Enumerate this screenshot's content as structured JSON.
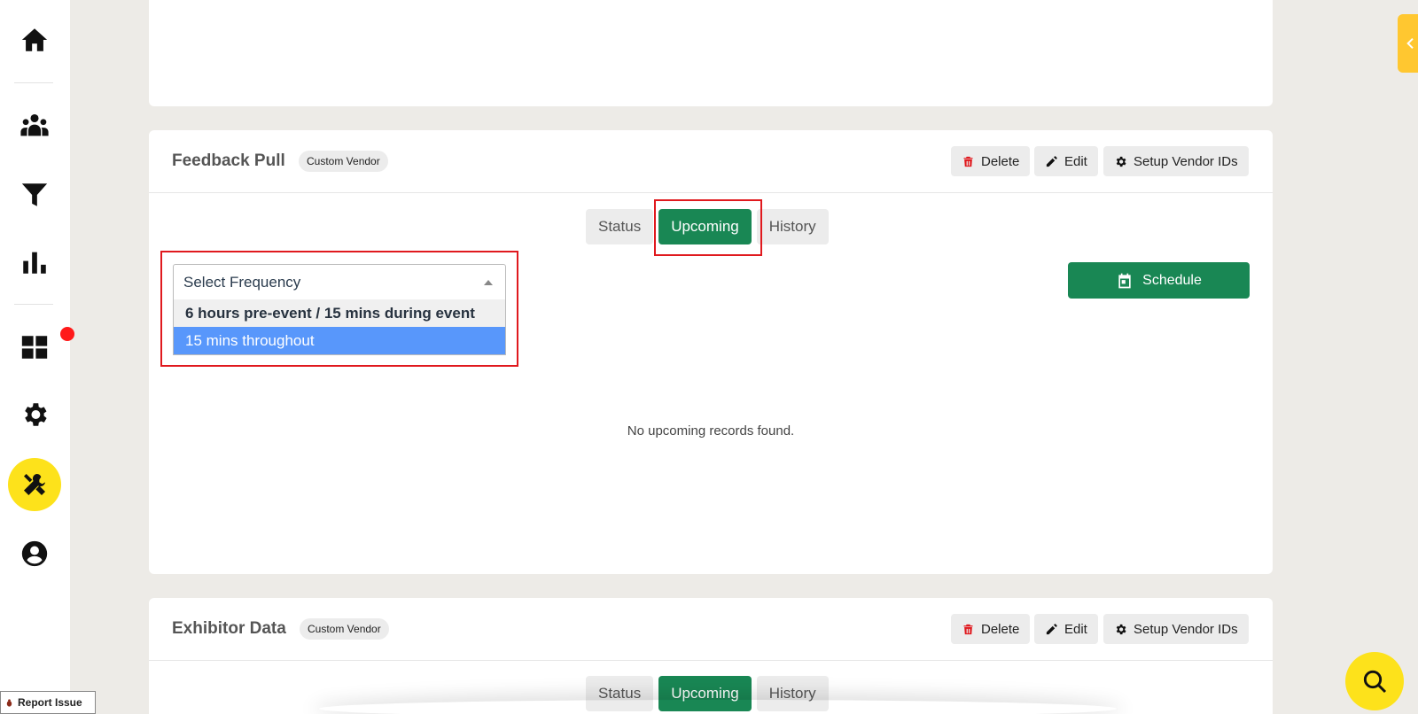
{
  "sidebar": {
    "items": [
      {
        "name": "home-icon"
      },
      {
        "name": "people-icon"
      },
      {
        "name": "filter-icon"
      },
      {
        "name": "bar-chart-icon"
      },
      {
        "name": "dashboard-icon"
      },
      {
        "name": "gear-icon"
      },
      {
        "name": "tools-icon",
        "active": true
      },
      {
        "name": "account-icon"
      }
    ]
  },
  "feedback": {
    "title": "Feedback Pull",
    "badge": "Custom Vendor",
    "delete_label": "Delete",
    "edit_label": "Edit",
    "setup_label": "Setup Vendor IDs",
    "tabs": [
      {
        "label": "Status"
      },
      {
        "label": "Upcoming",
        "active": true
      },
      {
        "label": "History"
      }
    ],
    "select_placeholder": "Select Frequency",
    "options": [
      {
        "label": "6 hours pre-event / 15 mins during event"
      },
      {
        "label": "15 mins throughout",
        "highlighted": true
      }
    ],
    "schedule_label": "Schedule",
    "empty_message": "No upcoming records found."
  },
  "exhibitor": {
    "title": "Exhibitor Data",
    "badge": "Custom Vendor",
    "delete_label": "Delete",
    "edit_label": "Edit",
    "setup_label": "Setup Vendor IDs",
    "tabs": [
      {
        "label": "Status"
      },
      {
        "label": "Upcoming",
        "active": true
      },
      {
        "label": "History"
      }
    ]
  },
  "footer": {
    "report_issue": "Report Issue"
  },
  "colors": {
    "accent_green": "#198754",
    "accent_yellow": "#fde21b",
    "highlight_red": "#e0191e",
    "option_hover": "#5897fb"
  }
}
